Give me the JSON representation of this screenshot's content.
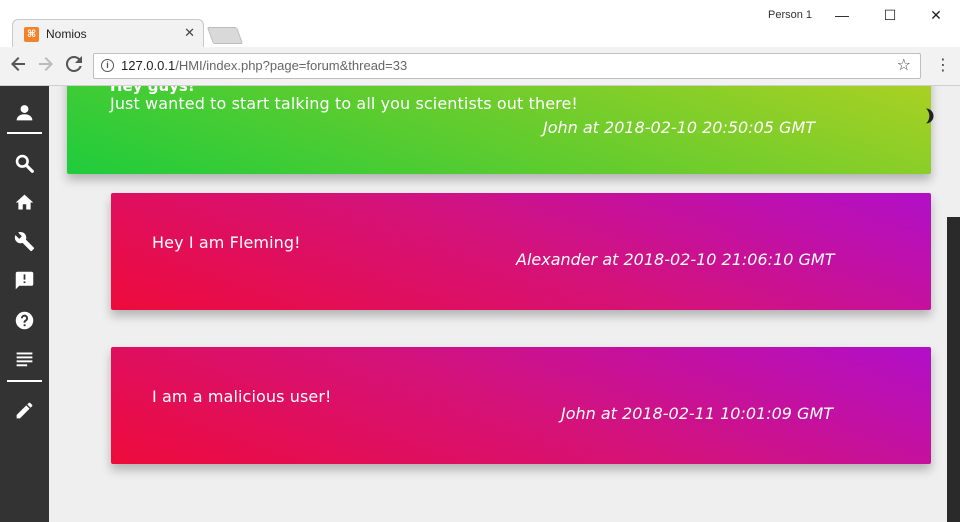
{
  "browser": {
    "tab_title": "Nomios",
    "tab_close": "✕",
    "profile_name": "Person 1",
    "window_controls": {
      "minimize": "—",
      "maximize": "☐",
      "close": "✕"
    },
    "url_host": "127.0.0.1",
    "url_path": "/HMI/index.php?page=forum&thread=33",
    "back_icon": "arrow-left-icon",
    "forward_icon": "arrow-right-icon",
    "reload_icon": "reload-icon"
  },
  "sidebar": {
    "items": [
      {
        "name": "user-icon"
      },
      {
        "name": "search-icon"
      },
      {
        "name": "home-icon"
      },
      {
        "name": "wrench-icon"
      },
      {
        "name": "feedback-icon"
      },
      {
        "name": "help-icon"
      },
      {
        "name": "list-icon"
      },
      {
        "name": "pencil-icon"
      }
    ]
  },
  "thread": {
    "posts": [
      {
        "heading": "Hey guys!",
        "body": "Just wanted to start talking to all you scientists out there!",
        "meta": "John at 2018-02-10 20:50:05 GMT",
        "color": "#5ccb2f"
      },
      {
        "body": "Hey I am Fleming!",
        "meta": "Alexander at 2018-02-10 21:06:10 GMT",
        "color": "#d4127a"
      },
      {
        "body": "I am a malicious user!",
        "meta": "John at 2018-02-11 10:01:09 GMT",
        "color": "#d4127a"
      }
    ]
  },
  "theme": {
    "sidebar_bg": "#333333",
    "page_bg": "#efefef"
  }
}
